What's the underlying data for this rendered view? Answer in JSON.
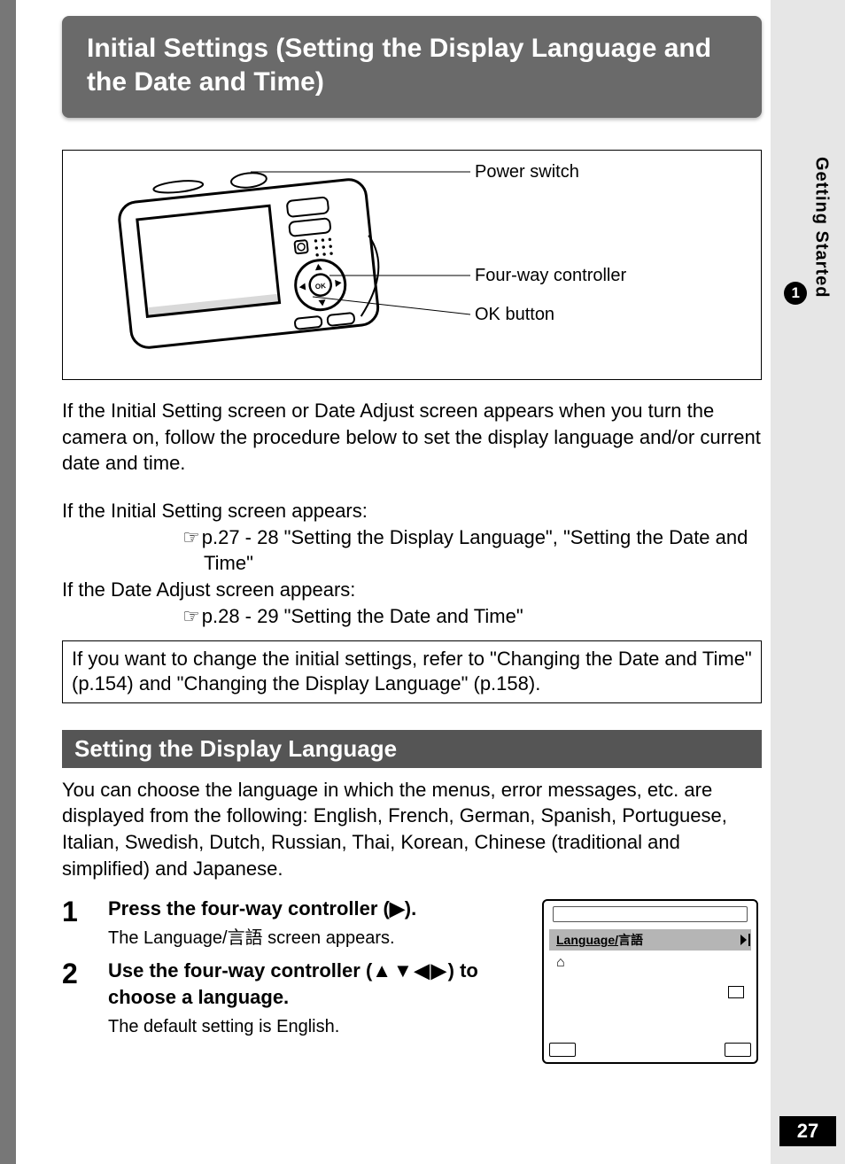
{
  "title": "Initial Settings (Setting the Display Language and the Date and Time)",
  "diagram": {
    "label1": "Power switch",
    "label2": "Four-way controller",
    "label3": "OK button"
  },
  "intro": "If the Initial Setting screen or Date Adjust screen appears when you turn the camera on, follow the procedure below to set the display language and/or current date and time.",
  "ref1_head": "If the Initial Setting screen appears:",
  "ref1_body": "p.27 - 28 \"Setting the Display Language\", \"Setting the Date and Time\"",
  "ref2_head": "If the Date Adjust screen appears:",
  "ref2_body": "p.28 - 29 \"Setting the Date and Time\"",
  "note": "If you want to change the initial settings, refer to \"Changing the Date and Time\" (p.154) and \"Changing the Display Language\" (p.158).",
  "section_title": "Setting the Display Language",
  "section_body": "You can choose the language in which the menus, error messages, etc. are displayed from the following: English, French, German, Spanish, Portuguese, Italian, Swedish, Dutch, Russian, Thai, Korean, Chinese (traditional and simplified) and Japanese.",
  "steps": {
    "s1_num": "1",
    "s1_head_a": "Press the four-way controller (",
    "s1_head_glyph": "▶",
    "s1_head_b": ").",
    "s1_sub_a": "The Language/",
    "s1_sub_jp": "言語",
    "s1_sub_b": "  screen appears.",
    "s2_num": "2",
    "s2_head_a": "Use the four-way controller (",
    "s2_head_glyphs": "▲▼◀▶",
    "s2_head_b": ") to choose a language.",
    "s2_sub": "The default setting is English."
  },
  "screen": {
    "row_en": "Language/",
    "row_jp": "言語"
  },
  "side": {
    "chapter_num": "1",
    "chapter_label": "Getting Started"
  },
  "page_number": "27"
}
